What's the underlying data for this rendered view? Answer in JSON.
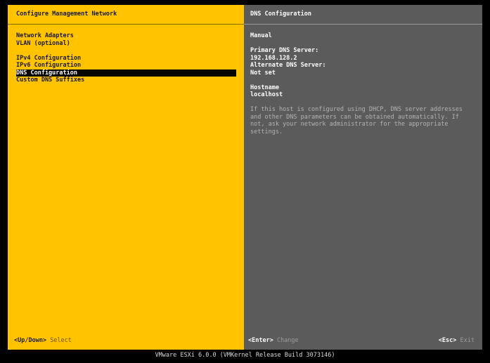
{
  "left_panel": {
    "title": "Configure Management Network",
    "menu_group_1": [
      {
        "label": "Network Adapters"
      },
      {
        "label": "VLAN (optional)"
      }
    ],
    "menu_group_2": [
      {
        "label": "IPv4 Configuration"
      },
      {
        "label": "IPv6 Configuration"
      },
      {
        "label": "DNS Configuration"
      },
      {
        "label": "Custom DNS Suffixes"
      }
    ],
    "footer": {
      "key": "<Up/Down>",
      "action": "Select"
    }
  },
  "right_panel": {
    "title": "DNS Configuration",
    "mode": "Manual",
    "primary_dns_label": "Primary DNS Server:",
    "primary_dns_value": "192.168.128.2",
    "alternate_dns_label": "Alternate DNS Server:",
    "alternate_dns_value": "Not set",
    "hostname_label": "Hostname",
    "hostname_value": "localhost",
    "help_text": "If this host is configured using DHCP, DNS server addresses and other DNS parameters can be obtained automatically. If not, ask your network administrator for the appropriate settings.",
    "footer_left": {
      "key": "<Enter>",
      "action": "Change"
    },
    "footer_right": {
      "key": "<Esc>",
      "action": "Exit"
    }
  },
  "status_bar": "VMware ESXi 6.0.0 (VMKernel Release Build 3073146)",
  "colors": {
    "left_bg": "#ffc300",
    "right_bg": "#5b5b5b",
    "selection_bg": "#000000",
    "selection_fg": "#ffffff"
  }
}
